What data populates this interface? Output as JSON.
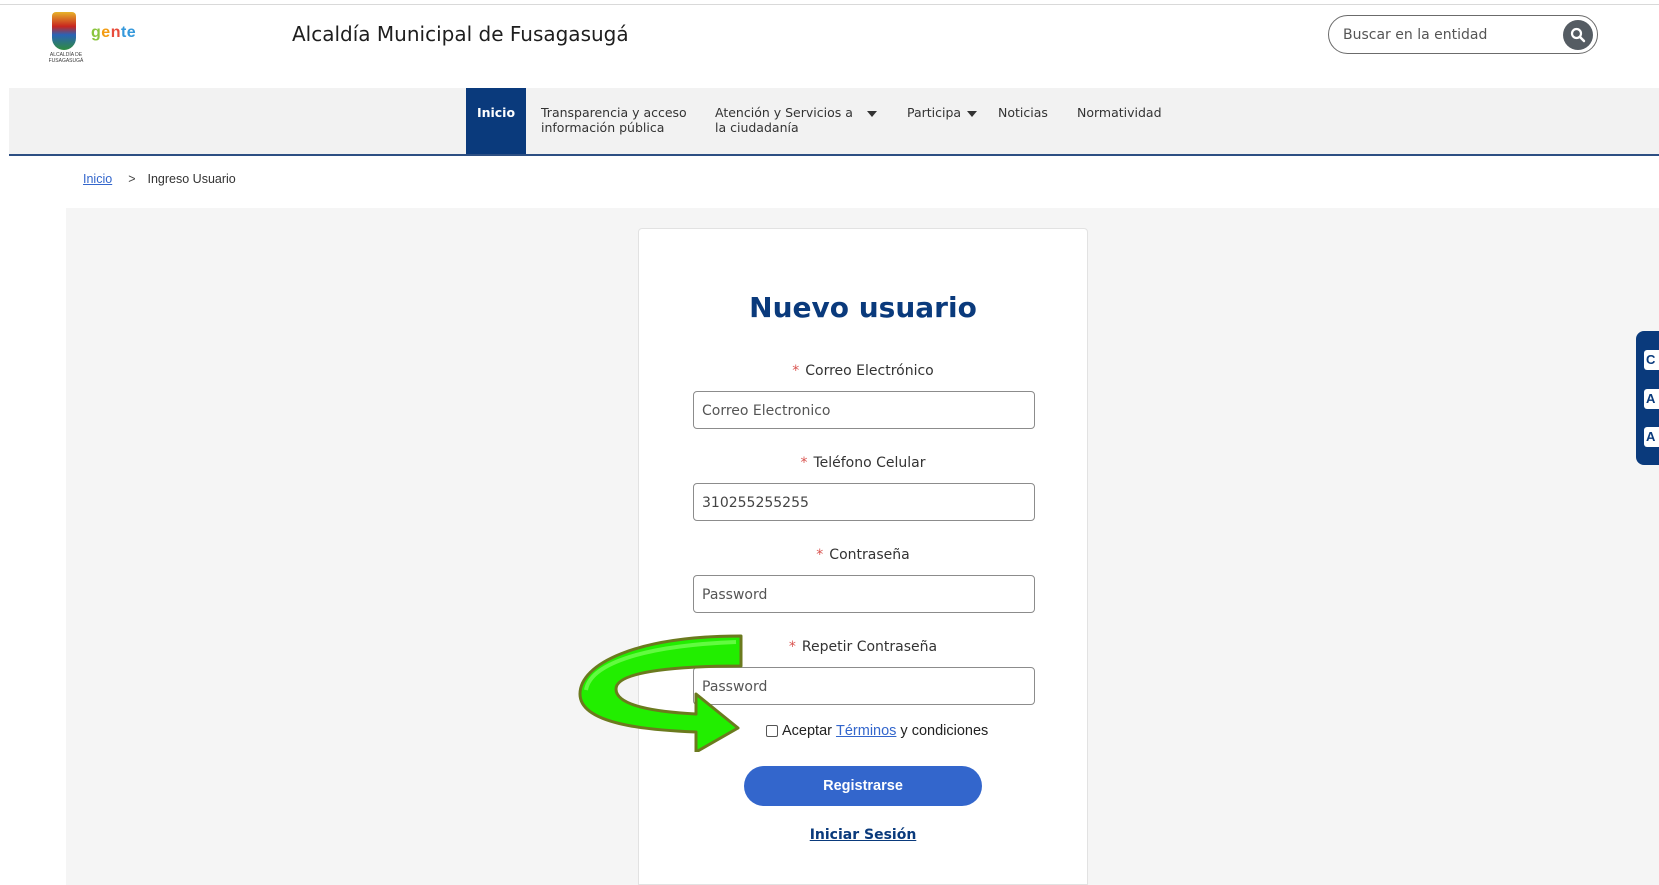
{
  "header": {
    "logo_caption": "ALCALDÍA DE FUSAGASUGÁ",
    "logo_brand": "gente",
    "site_title": "Alcaldía Municipal de Fusagasugá",
    "search_placeholder": "Buscar en la entidad"
  },
  "nav": {
    "items": [
      {
        "line1": "Inicio",
        "line2": ""
      },
      {
        "line1": "Transparencia y acceso",
        "line2": "información pública"
      },
      {
        "line1": "Atención y Servicios a",
        "line2": "la ciudadanía"
      },
      {
        "line1": "Participa",
        "line2": ""
      },
      {
        "line1": "Noticias",
        "line2": ""
      },
      {
        "line1": "Normatividad",
        "line2": ""
      }
    ]
  },
  "breadcrumb": {
    "home": "Inicio",
    "separator": ">",
    "current": "Ingreso Usuario"
  },
  "form": {
    "title": "Nuevo usuario",
    "required_mark": "*",
    "email_label": "Correo Electrónico",
    "email_placeholder": "Correo Electronico",
    "phone_label": "Teléfono Celular",
    "phone_value": "310255255255",
    "password_label": "Contraseña",
    "password_placeholder": "Password",
    "repeat_label": "Repetir Contraseña",
    "repeat_placeholder": "Password",
    "terms_prefix": "Aceptar",
    "terms_link": "Términos",
    "terms_suffix": "y condiciones",
    "register_button": "Registrarse",
    "login_link": "Iniciar Sesión"
  },
  "accessibility_bar": {
    "buttons": [
      "C",
      "A",
      "A"
    ]
  },
  "colors": {
    "primary": "#0a3a7c",
    "button": "#3366cc",
    "required": "#d9534f",
    "annotation_arrow": "#22ee00"
  }
}
